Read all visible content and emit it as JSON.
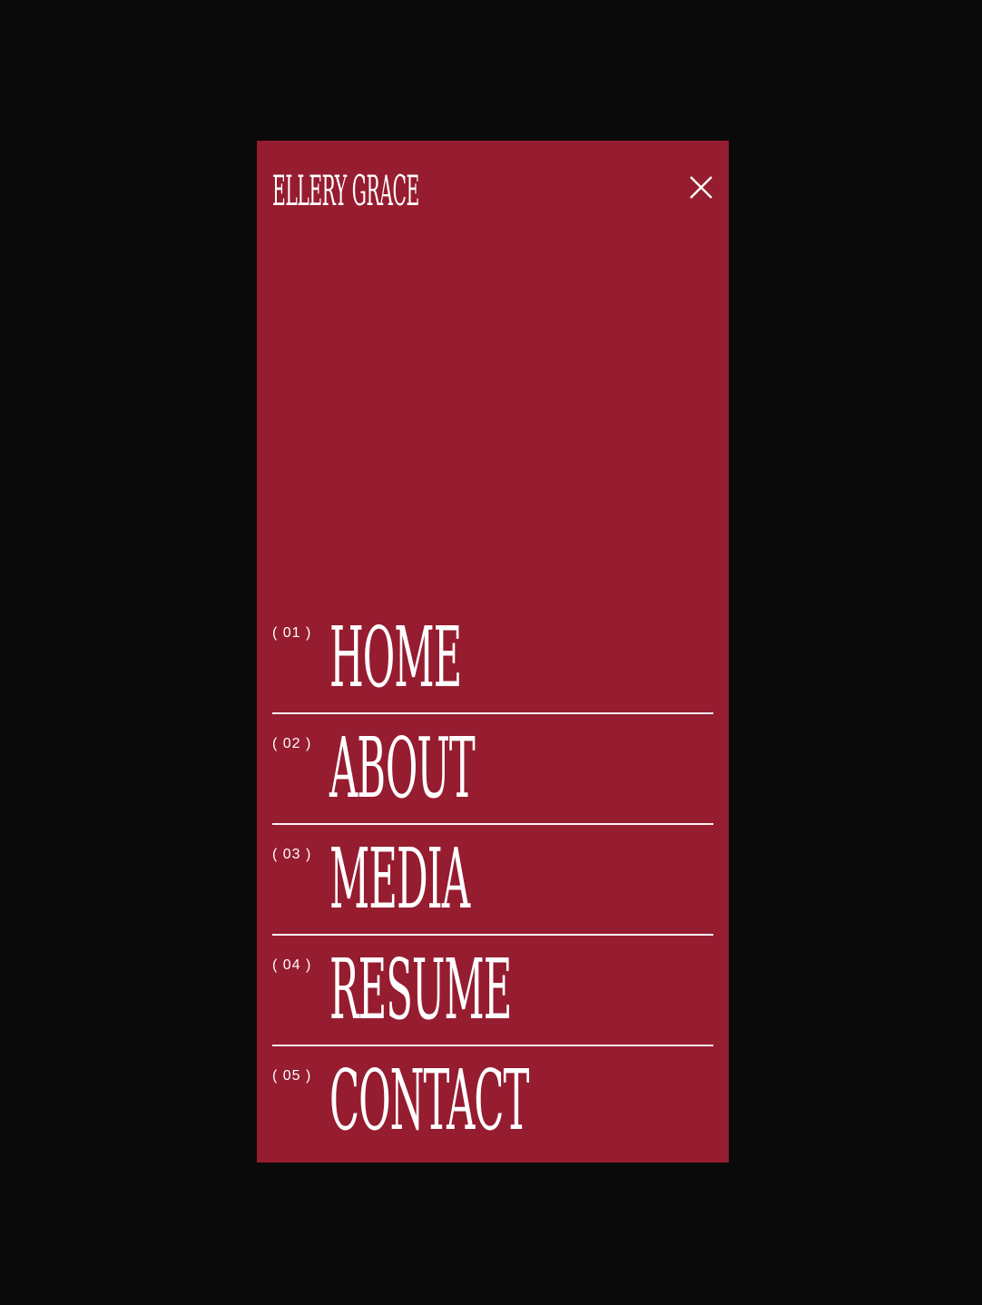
{
  "header": {
    "brand": "ELLERY GRACE",
    "close_icon": "close-icon"
  },
  "menu": {
    "items": [
      {
        "number": "( 01 )",
        "label": "HOME"
      },
      {
        "number": "( 02 )",
        "label": "ABOUT"
      },
      {
        "number": "( 03 )",
        "label": "MEDIA"
      },
      {
        "number": "( 04 )",
        "label": "RESUME"
      },
      {
        "number": "( 05 )",
        "label": "CONTACT"
      }
    ]
  },
  "colors": {
    "background": "#0a0a0a",
    "panel": "#961c30",
    "text": "#ffffff"
  }
}
